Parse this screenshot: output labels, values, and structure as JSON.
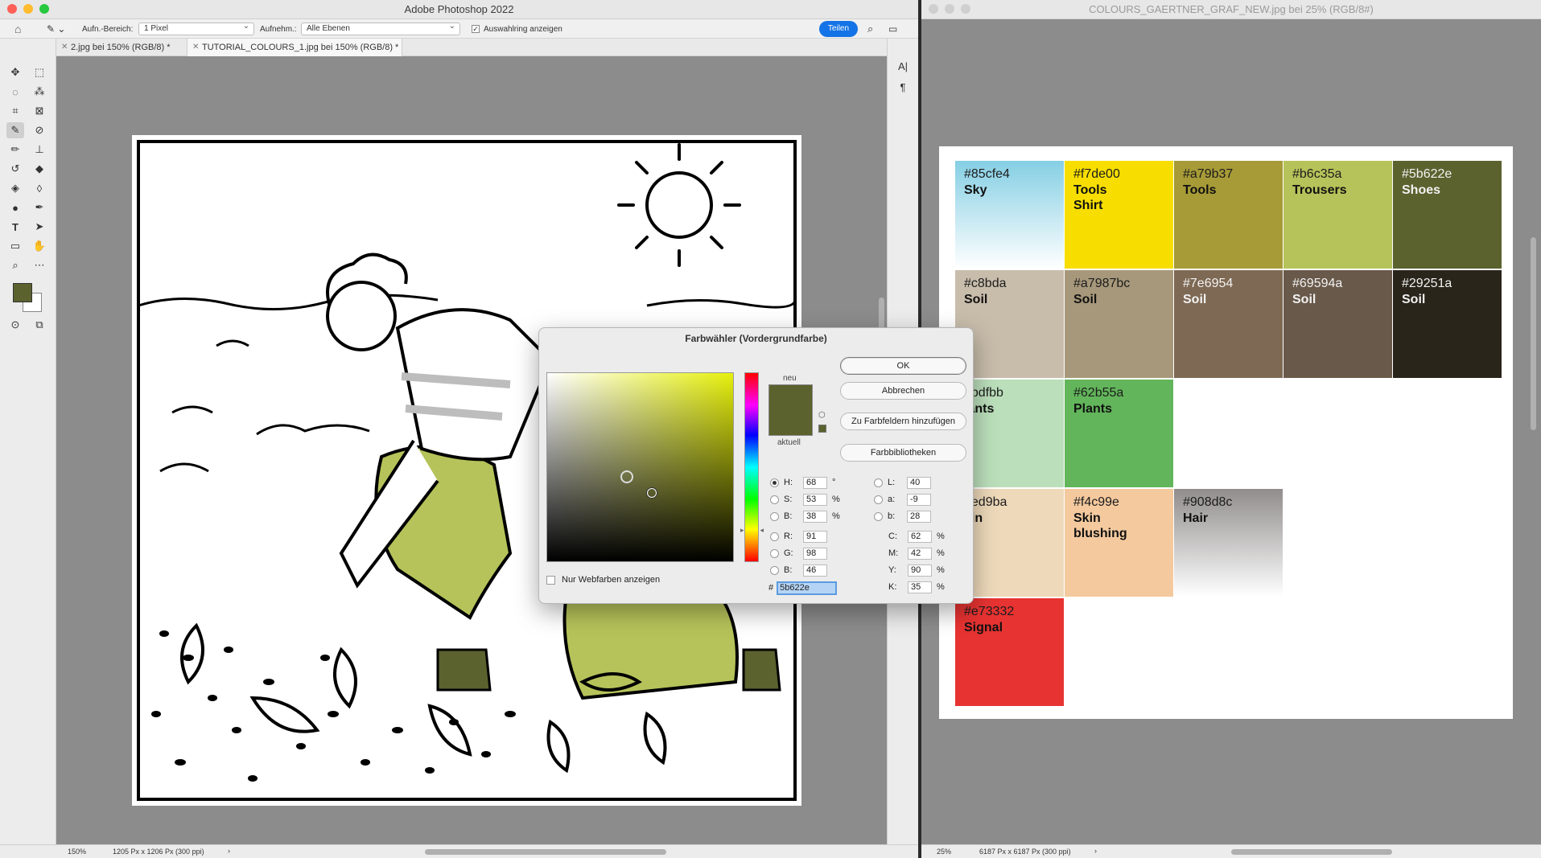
{
  "left_window": {
    "title": "Adobe Photoshop 2022",
    "options": {
      "sample_size_label": "Aufn.-Bereich:",
      "sample_size_value": "1 Pixel",
      "sample_layers_label": "Aufnehm.:",
      "sample_layers_value": "Alle Ebenen",
      "show_ring_label": "Auswahlring anzeigen",
      "share_label": "Teilen"
    },
    "tabs": [
      {
        "label": "2.jpg bei 150% (RGB/8) *"
      },
      {
        "label": "TUTORIAL_COLOURS_1.jpg bei 150% (RGB/8) *"
      }
    ],
    "status": {
      "zoom": "150%",
      "info": "1205 Px x 1206 Px (300 ppi)"
    },
    "foreground_color": "#5b622e"
  },
  "right_window": {
    "title": "COLOURS_GAERTNER_GRAF_NEW.jpg bei 25% (RGB/8#)",
    "status": {
      "zoom": "25%",
      "info": "6187 Px x 6187 Px (300 ppi)"
    }
  },
  "swatches": [
    {
      "hex": "#85cfe4",
      "name": "Sky",
      "color": "#85cfe4",
      "gradient": true
    },
    {
      "hex": "#f7de00",
      "name": "Tools\nShirt",
      "color": "#f7de00"
    },
    {
      "hex": "#a79b37",
      "name": "Tools",
      "color": "#a79b37"
    },
    {
      "hex": "#b6c35a",
      "name": "Trousers",
      "color": "#b6c35a"
    },
    {
      "hex": "#5b622e",
      "name": "Shoes",
      "color": "#5b622e",
      "dark": true
    },
    {
      "hex": "#c8bda",
      "name": "Soil",
      "color": "#c8bdab"
    },
    {
      "hex": "#a7987bc",
      "name": "Soil",
      "color": "#a7987b"
    },
    {
      "hex": "#7e6954",
      "name": "Soil",
      "color": "#7e6954",
      "dark": true
    },
    {
      "hex": "#69594a",
      "name": "Soil",
      "color": "#69594a",
      "dark": true
    },
    {
      "hex": "#29251a",
      "name": "Soil",
      "color": "#29251a",
      "dark": true
    },
    {
      "hex": "bbdfbb",
      "name": "lants",
      "color": "#bbdfbb"
    },
    {
      "hex": "#62b55a",
      "name": "Plants",
      "color": "#62b55a"
    },
    {
      "hex": "eed9ba",
      "name": "kin",
      "color": "#eed9ba"
    },
    {
      "hex": "#f4c99e",
      "name": "Skin\nblushing",
      "color": "#f4c99e"
    },
    {
      "hex": "#908d8c",
      "name": "Hair",
      "color": "#908d8c",
      "gradient": true
    },
    {
      "hex": "#e73332",
      "name": "Signal",
      "color": "#e73332"
    }
  ],
  "dialog": {
    "title": "Farbwähler (Vordergrundfarbe)",
    "ok": "OK",
    "cancel": "Abbrechen",
    "add_swatch": "Zu Farbfeldern hinzufügen",
    "libraries": "Farbbibliotheken",
    "new_label": "neu",
    "current_label": "aktuell",
    "web_only": "Nur Webfarben anzeigen",
    "hue_color": "#e6f00c",
    "new_color": "#5b622e",
    "current_color": "#5b622e",
    "values": {
      "H": "68",
      "S": "53",
      "B": "38",
      "R": "91",
      "G": "98",
      "Bv": "46",
      "L": "40",
      "a": "-9",
      "b": "28",
      "C": "62",
      "M": "42",
      "Y": "90",
      "K": "35",
      "hex": "5b622e"
    },
    "units": {
      "deg": "°",
      "pct": "%"
    }
  }
}
